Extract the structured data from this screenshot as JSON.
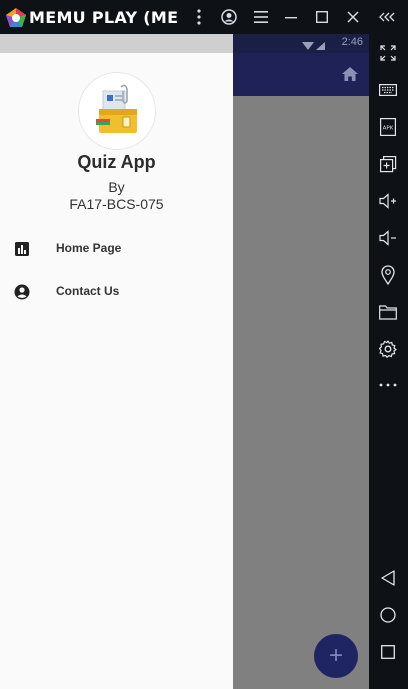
{
  "emulator": {
    "brand": "MEMU PLAY (ME",
    "titlebar_buttons": [
      "more-vert-icon",
      "account-icon",
      "menu-icon",
      "minimize-icon",
      "maximize-icon",
      "close-icon",
      "collapse-icon"
    ],
    "side_tools": [
      "fullscreen-icon",
      "keyboard-icon",
      "apk-install-icon",
      "multi-instance-icon",
      "volume-up-icon",
      "volume-down-icon",
      "location-icon",
      "folder-icon",
      "settings-icon",
      "more-horiz-icon",
      "back-icon",
      "home-icon",
      "recents-icon"
    ],
    "apk_label": "APK"
  },
  "status": {
    "time": "2:46"
  },
  "drawer": {
    "title": "Quiz App",
    "by": "By",
    "id": "FA17-BCS-075",
    "items": [
      {
        "label": "Home Page",
        "icon": "bar-chart-icon"
      },
      {
        "label": "Contact Us",
        "icon": "account-circle-icon"
      }
    ]
  },
  "fab": {
    "label": "+"
  },
  "colors": {
    "appbar": "#1e2257",
    "fab": "#1f2563",
    "drawer": "#fafafa",
    "scrim": "#808080"
  }
}
